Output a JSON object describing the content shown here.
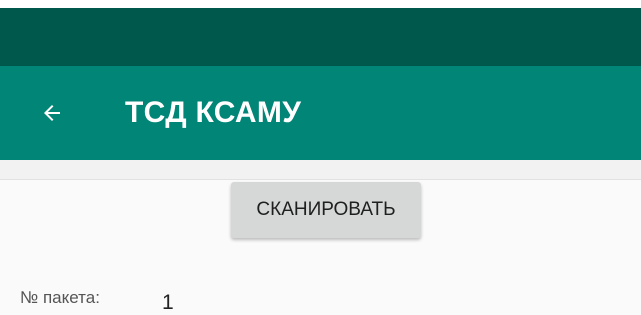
{
  "app_bar": {
    "title": "ТСД КСАМУ",
    "back_icon": "arrow-back-icon",
    "background_color": "#008577"
  },
  "status_bar": {
    "background_color": "#00574b"
  },
  "main": {
    "scan_button_label": "СКАНИРОВАТЬ",
    "package_label": "№ пакета:",
    "package_value": "1"
  }
}
